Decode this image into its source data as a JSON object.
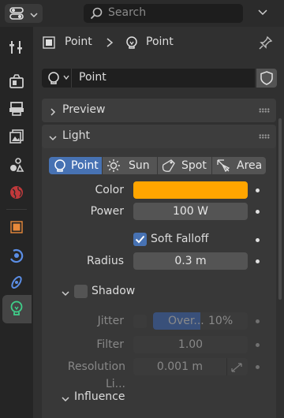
{
  "search": {
    "placeholder": "Search"
  },
  "breadcrumb": {
    "object": "Point",
    "data": "Point"
  },
  "datablock": {
    "name": "Point"
  },
  "panels": {
    "preview": "Preview",
    "light": "Light",
    "shadow": "Shadow",
    "influence": "Influence"
  },
  "light_types": [
    {
      "label": "Point",
      "icon": "point-light-icon",
      "active": true
    },
    {
      "label": "Sun",
      "icon": "sun-light-icon",
      "active": false
    },
    {
      "label": "Spot",
      "icon": "spot-light-icon",
      "active": false
    },
    {
      "label": "Area",
      "icon": "area-light-icon",
      "active": false
    }
  ],
  "light": {
    "color_label": "Color",
    "color_value": "#ffa500",
    "power_label": "Power",
    "power_value": "100 W",
    "soft_falloff_label": "Soft Falloff",
    "soft_falloff_checked": true,
    "radius_label": "Radius",
    "radius_value": "0.3 m"
  },
  "shadow": {
    "enabled": false,
    "jitter_label": "Jitter",
    "jitter_text": "Over...",
    "jitter_value": "10%",
    "jitter_fraction": 0.1,
    "filter_label": "Filter",
    "filter_value": "1.00",
    "resolution_label": "Resolution Li...",
    "resolution_value": "0.001 m"
  },
  "colors": {
    "accent": "#4772b3",
    "panel": "#3d3d3d",
    "field": "#545454",
    "background": "#303030"
  }
}
